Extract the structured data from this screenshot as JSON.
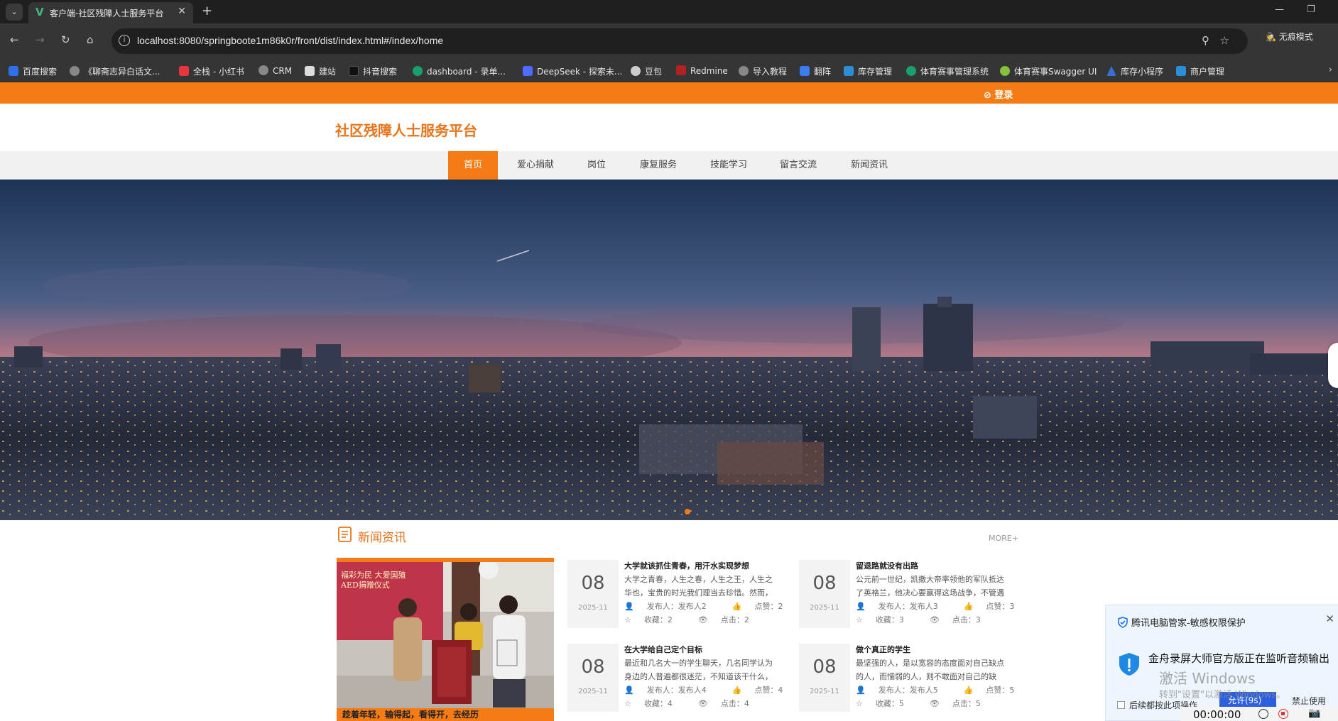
{
  "browser": {
    "tab_title": "客户端-社区残障人士服务平台",
    "url": "localhost:8080/springboote1m86k0r/front/dist/index.html#/index/home",
    "incognito_label": "无痕模式",
    "bookmarks": [
      "百度搜索",
      "《聊斋志异白话文...",
      "全栈 - 小红书",
      "CRM",
      "建站",
      "抖音搜索",
      "dashboard - 录单...",
      "DeepSeek - 探索未...",
      "豆包",
      "Redmine",
      "导入教程",
      "翻阵",
      "库存管理",
      "体育赛事管理系统",
      "体育赛事Swagger UI",
      "库存小程序",
      "商户管理"
    ]
  },
  "site": {
    "login_label": "登录",
    "title": "社区残障人士服务平台",
    "menu": [
      "首页",
      "爱心捐献",
      "岗位",
      "康复服务",
      "技能学习",
      "留言交流",
      "新闻资讯"
    ],
    "active_menu_index": 0,
    "carousel_active_index": 0
  },
  "news": {
    "section_title": "新闻资讯",
    "more_label": "MORE+",
    "featured_caption": "趁着年轻，输得起，看得开，去经历",
    "photo_banner_text": "福彩为民  大爱国殖 AED捐赠仪式",
    "items": [
      {
        "day": "08",
        "ym": "2025-11",
        "title": "大学就该抓住青春，用汗水实现梦想",
        "summary": "大学之青春，人生之春，人生之王，人生之华也，宝贵的时光我们理当去珍惜。然而，",
        "author": "发布人：发布人2",
        "likes": "点赞：2",
        "favs": "收藏：2",
        "clicks": "点击：2"
      },
      {
        "day": "08",
        "ym": "2025-11",
        "title": "留退路就没有出路",
        "summary": "公元前一世纪，凯撒大帝率领他的军队抵达了英格兰，他决心要赢得这场战争，不管遇",
        "author": "发布人：发布人3",
        "likes": "点赞：3",
        "favs": "收藏：3",
        "clicks": "点击：3"
      },
      {
        "day": "08",
        "ym": "2025-11",
        "title": "在大学给自己定个目标",
        "summary": "最近和几名大一的学生聊天，几名同学认为身边的人普遍都很迷茫，不知道该干什么，",
        "author": "发布人：发布人4",
        "likes": "点赞：4",
        "favs": "收藏：4",
        "clicks": "点击：4"
      },
      {
        "day": "08",
        "ym": "2025-11",
        "title": "做个真正的学生",
        "summary": "最坚强的人，是以宽容的态度面对自己缺点的人，而懦弱的人，则不敢面对自己的缺",
        "author": "发布人：发布人5",
        "likes": "点赞：5",
        "favs": "收藏：5",
        "clicks": "点击：5"
      }
    ]
  },
  "overlay": {
    "popup_title": "腾讯电脑管家-敏感权限保护",
    "popup_message": "金舟录屏大师官方版正在监听音频输出",
    "popup_checkbox": "后续都按此项操作",
    "popup_stop_label": "禁止使用",
    "popup_allow_label": "允许(9s)",
    "watermark_title": "激活 Windows",
    "watermark_sub": "转到\"设置\"以激活 Windows。",
    "recorder_time": "00:00:00"
  }
}
